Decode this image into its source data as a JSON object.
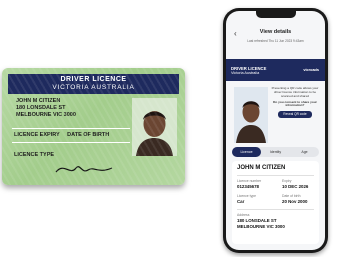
{
  "card": {
    "title": "DRIVER LICENCE",
    "state": "VICTORIA AUSTRALIA",
    "name": "JOHN M CITIZEN",
    "address_line1": "180 LONSDALE ST",
    "address_line2": "MELBOURNE VIC 3000",
    "expiry_label": "LICENCE EXPIRY",
    "dob_label": "DATE OF BIRTH",
    "type_label": "LICENCE TYPE"
  },
  "phone": {
    "title": "View details",
    "refresh_text": "Last refreshed Thu 11 Jun 2023 9:43am",
    "licence_title": "DRIVER LICENCE",
    "licence_state": "Victoria Australia",
    "logo": "vicroads",
    "qr_prompt": "Presenting a QR code allows your driver licence information to be scanned and shared",
    "consent_question": "Do you consent to share your information?",
    "reveal_button": "Reveal QR code",
    "tabs": [
      "Licence",
      "Identity",
      "Age"
    ],
    "person_name": "JOHN M CITIZEN",
    "fields": {
      "licence_number_label": "Licence number",
      "licence_number": "012345678",
      "expiry_label": "Expiry",
      "expiry": "10 DEC 2026",
      "licence_type_label": "Licence type",
      "licence_type": "Car",
      "dob_label": "Date of birth",
      "dob": "20 Nov 2000",
      "address_label": "Address",
      "address_line1": "180 LONSDALE ST",
      "address_line2": "MELBOURNE VIC 3000"
    }
  },
  "colors": {
    "navy": "#1e2a5e",
    "card_green": "#a3cd8c"
  }
}
